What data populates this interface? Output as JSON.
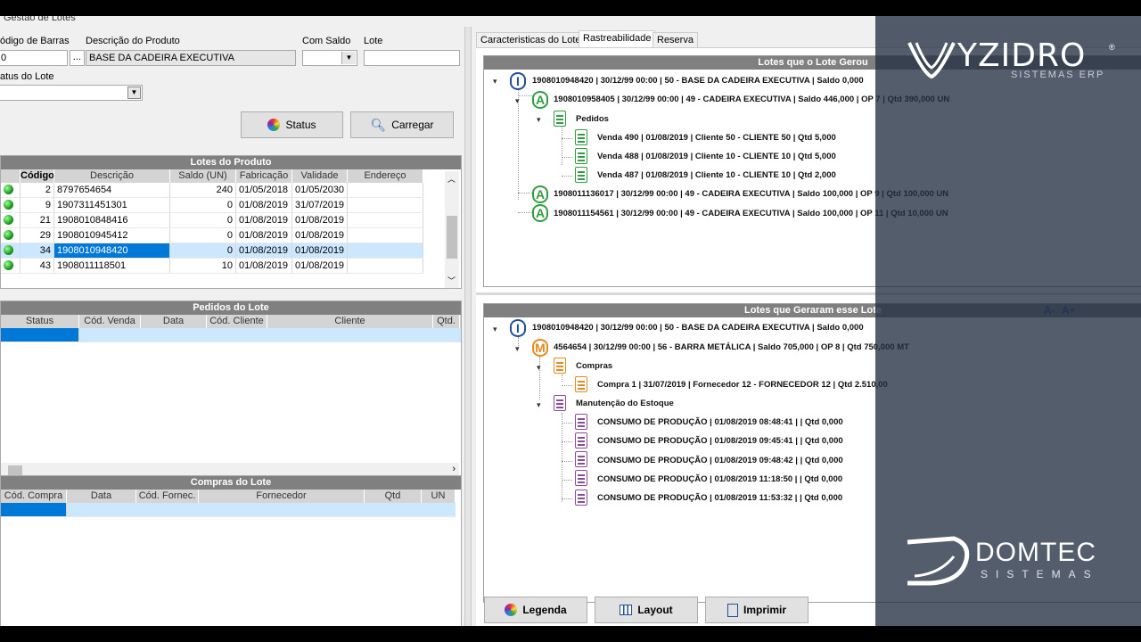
{
  "window_title": "Gestão de Lotes",
  "filters": {
    "codigo_barras_label": "ódigo de Barras",
    "codigo_barras_value": "0",
    "descricao_label": "Descrição do Produto",
    "descricao_value": "BASE DA CADEIRA EXECUTIVA",
    "com_saldo_label": "Com Saldo",
    "lote_label": "Lote",
    "status_lote_label": "atus do Lote",
    "ellipsis": "..."
  },
  "buttons": {
    "status": "Status",
    "carregar": "Carregar",
    "legenda": "Legenda",
    "layout": "Layout",
    "imprimir": "Imprimir"
  },
  "lotes_produto": {
    "title": "Lotes do Produto",
    "columns": [
      "Código",
      "Descrição",
      "Saldo (UN)",
      "Fabricação",
      "Validade",
      "Endereço"
    ],
    "rows": [
      {
        "codigo": "2",
        "descricao": "8797654654",
        "saldo": "240",
        "fab": "01/05/2018",
        "val": "01/05/2030"
      },
      {
        "codigo": "9",
        "descricao": "1907311451301",
        "saldo": "0",
        "fab": "01/08/2019",
        "val": "31/07/2019"
      },
      {
        "codigo": "21",
        "descricao": "1908010848416",
        "saldo": "0",
        "fab": "01/08/2019",
        "val": "01/08/2019"
      },
      {
        "codigo": "29",
        "descricao": "1908010945412",
        "saldo": "0",
        "fab": "01/08/2019",
        "val": "01/08/2019"
      },
      {
        "codigo": "34",
        "descricao": "1908010948420",
        "saldo": "0",
        "fab": "01/08/2019",
        "val": "01/08/2019"
      },
      {
        "codigo": "43",
        "descricao": "1908011118501",
        "saldo": "10",
        "fab": "01/08/2019",
        "val": "01/08/2019"
      }
    ]
  },
  "pedidos_lote": {
    "title": "Pedidos do Lote",
    "columns": [
      "Status",
      "Cód. Venda",
      "Data",
      "Cód. Cliente",
      "Cliente",
      "Qtd."
    ]
  },
  "compras_lote": {
    "title": "Compras do Lote",
    "columns": [
      "Cód. Compra",
      "Data",
      "Cód. Fornec.",
      "Fornecedor",
      "Qtd",
      "UN"
    ]
  },
  "tabs": [
    "Caracteristicas do Lote",
    "Rastreabilidade",
    "Reserva"
  ],
  "gerou": {
    "title": "Lotes que o Lote Gerou",
    "root": "1908010948420 | 30/12/99 00:00 | 50 - BASE DA CADEIRA EXECUTIVA | Saldo 0,000",
    "n1": "1908010958405 | 30/12/99 00:00 | 49 - CADEIRA EXECUTIVA | Saldo 446,000 | OP 7 | Qtd 390,000 UN",
    "pedidos": "Pedidos",
    "v1": "Venda 490 | 01/08/2019 | Cliente 50 - CLIENTE 50 | Qtd 5,000",
    "v2": "Venda 488 | 01/08/2019 | Cliente 10 - CLIENTE 10 | Qtd 5,000",
    "v3": "Venda 487 | 01/08/2019 | Cliente 10 - CLIENTE 10 | Qtd 2,000",
    "n2": "1908011136017 | 30/12/99 00:00 | 49 - CADEIRA EXECUTIVA | Saldo 100,000 | OP 9 | Qtd 100,000 UN",
    "n3": "1908011154561 | 30/12/99 00:00 | 49 - CADEIRA EXECUTIVA | Saldo 100,000 | OP 11 | Qtd 10,000 UN"
  },
  "geraram": {
    "title": "Lotes que Geraram esse Lote",
    "root": "1908010948420 | 30/12/99 00:00 | 50 - BASE DA CADEIRA EXECUTIVA | Saldo 0,000",
    "m1": "4564654 | 30/12/99 00:00 | 56 - BARRA METÁLICA | Saldo 705,000 | OP 8 | Qtd 750,000 MT",
    "compras": "Compras",
    "c1": "Compra 1 | 31/07/2019 | Fornecedor 12 - FORNECEDOR 12 | Qtd 2.510,00",
    "manut": "Manutenção do Estoque",
    "k1": "CONSUMO DE PRODUÇÃO | 01/08/2019 08:48:41 |  | Qtd 0,000",
    "k2": "CONSUMO DE PRODUÇÃO | 01/08/2019 09:45:41 |  | Qtd 0,000",
    "k3": "CONSUMO DE PRODUÇÃO | 01/08/2019 09:48:42 |  | Qtd 0,000",
    "k4": "CONSUMO DE PRODUÇÃO | 01/08/2019 11:18:50 |  | Qtd 0,000",
    "k5": "CONSUMO DE PRODUÇÃO | 01/08/2019 11:53:32 |  | Qtd 0,000",
    "zoom_minus": "A-",
    "zoom_plus": "A+"
  },
  "brand": {
    "yzidro": "YZIDRO",
    "yzidro_sub": "SISTEMAS ERP",
    "domtec": "DOMTEC",
    "domtec_sub": "SISTEMAS"
  },
  "colors": {
    "green": "#2e9e3e",
    "orange": "#e58a1e",
    "purple": "#8b4a9c",
    "blue": "#1f4e9a",
    "selection": "#0078d7"
  }
}
